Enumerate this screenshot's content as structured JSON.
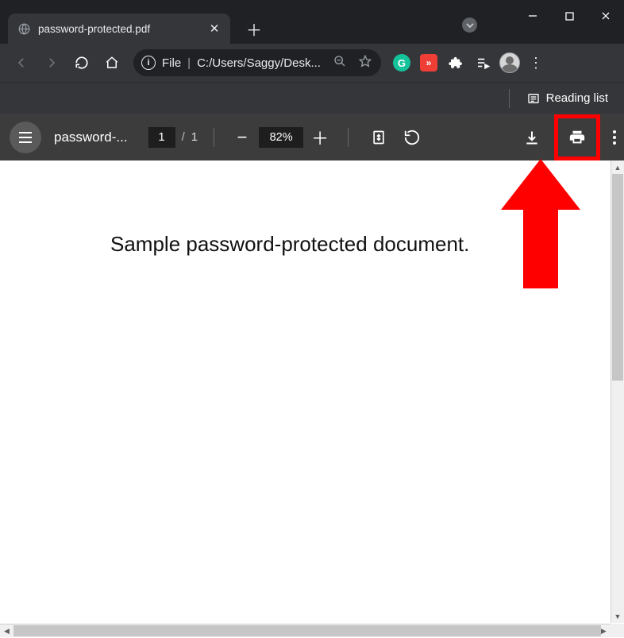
{
  "browser": {
    "tab_title": "password-protected.pdf",
    "url_scheme": "File",
    "url_path": "C:/Users/Saggy/Desk...",
    "reading_list_label": "Reading list"
  },
  "pdf": {
    "filename_truncated": "password-...",
    "current_page": "1",
    "page_count": "1",
    "page_separator": "/",
    "zoom_level": "82%"
  },
  "document": {
    "body_text": "Sample password-protected document."
  }
}
